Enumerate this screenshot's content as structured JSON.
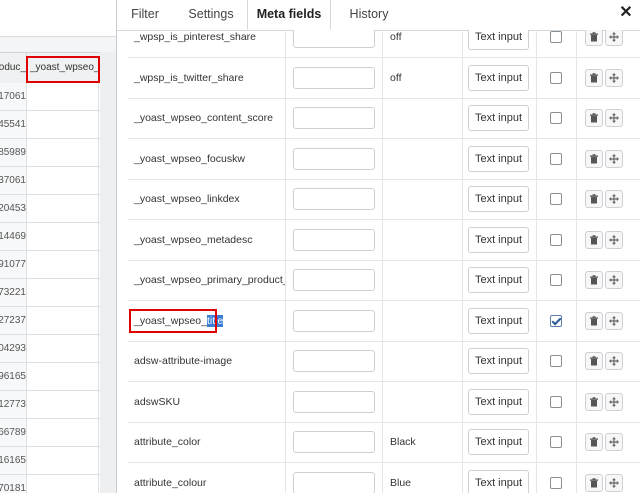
{
  "background_sheet": {
    "column_prev_header": "_produc",
    "column_header": "_yoast_wpseo_tit",
    "row_values": [
      "17061",
      "45541",
      "85989",
      "37061",
      "20453",
      "14469",
      "91077",
      "73221",
      "27237",
      "04293",
      "96165",
      "12773",
      "66789",
      "16165",
      "70181"
    ]
  },
  "modal": {
    "tabs": [
      {
        "label": "Filter",
        "active": false
      },
      {
        "label": "Settings",
        "active": false
      },
      {
        "label": "Meta fields",
        "active": true
      },
      {
        "label": "History",
        "active": false
      }
    ],
    "close_label": "✕",
    "button_label": "Text input",
    "rows": [
      {
        "name": "_wpsp_is_pinterest_share",
        "value": "off",
        "checked": false
      },
      {
        "name": "_wpsp_is_twitter_share",
        "value": "off",
        "checked": false
      },
      {
        "name": "_yoast_wpseo_content_score",
        "value": "",
        "checked": false
      },
      {
        "name": "_yoast_wpseo_focuskw",
        "value": "",
        "checked": false
      },
      {
        "name": "_yoast_wpseo_linkdex",
        "value": "",
        "checked": false
      },
      {
        "name": "_yoast_wpseo_metadesc",
        "value": "",
        "checked": false
      },
      {
        "name": "_yoast_wpseo_primary_product_cat",
        "value": "",
        "checked": false
      },
      {
        "name": "_yoast_wpseo_title",
        "name_prefix": "_yoast_wpseo_",
        "name_selected": "title",
        "value": "",
        "checked": true,
        "highlighted": true
      },
      {
        "name": "adsw-attribute-image",
        "value": "",
        "checked": false
      },
      {
        "name": "adswSKU",
        "value": "",
        "checked": false
      },
      {
        "name": "attribute_color",
        "value": "Black",
        "checked": false
      },
      {
        "name": "attribute_colour",
        "value": "Blue",
        "checked": false
      }
    ]
  },
  "icons": {
    "delete": "trash-icon",
    "move": "move-arrows-icon",
    "close": "close-icon"
  }
}
